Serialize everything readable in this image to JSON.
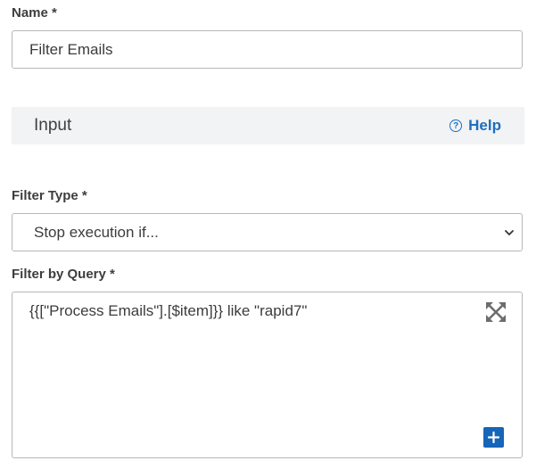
{
  "name": {
    "label": "Name *",
    "value": "Filter Emails"
  },
  "section": {
    "title": "Input",
    "help_label": "Help",
    "help_icon": "question-circle-icon"
  },
  "filter_type": {
    "label": "Filter Type *",
    "selected": "Stop execution if..."
  },
  "filter_query": {
    "label": "Filter by Query *",
    "value": "{{[\"Process Emails\"].[$item]}} like \"rapid7\"",
    "expand_icon": "expand-icon",
    "add_icon": "plus-icon"
  },
  "colors": {
    "accent": "#1b6fc0",
    "button": "#1565b8",
    "section_bg": "#f2f3f4",
    "border": "#b7b7b7"
  }
}
